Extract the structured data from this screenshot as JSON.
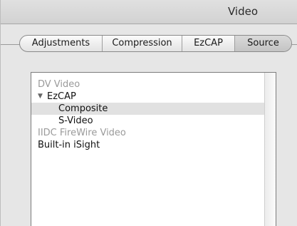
{
  "window": {
    "title": "Video"
  },
  "tabs": [
    {
      "label": "Adjustments"
    },
    {
      "label": "Compression"
    },
    {
      "label": "EzCAP"
    },
    {
      "label": "Source"
    }
  ],
  "selected_tab": "Source",
  "device_list": {
    "items": [
      {
        "label": "DV Video",
        "state": "disabled",
        "level": 0
      },
      {
        "label": "EzCAP",
        "state": "enabled",
        "level": 0,
        "expanded": true,
        "disclosure_icon": "triangle-down-icon"
      },
      {
        "label": "Composite",
        "state": "enabled",
        "level": 1,
        "selected": true
      },
      {
        "label": "S-Video",
        "state": "enabled",
        "level": 1
      },
      {
        "label": "IIDC FireWire Video",
        "state": "disabled",
        "level": 0
      },
      {
        "label": "Built-in iSight",
        "state": "enabled",
        "level": 0
      }
    ],
    "disclosure_glyph": "▼"
  }
}
